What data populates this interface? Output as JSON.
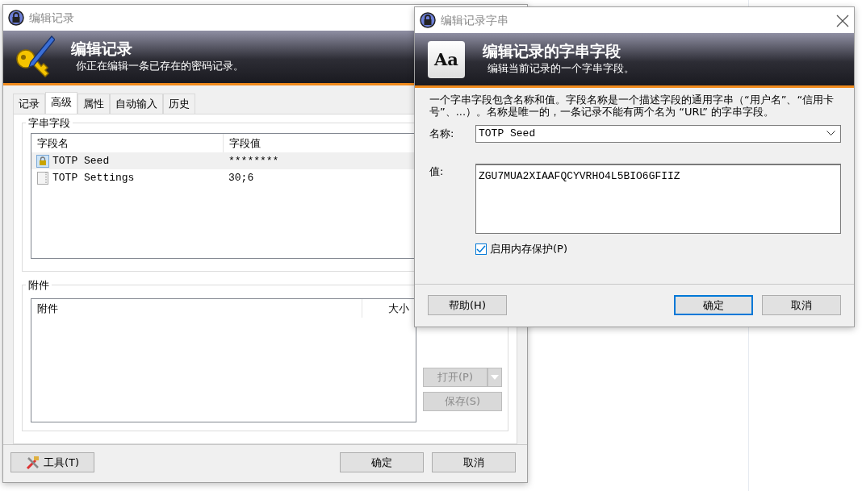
{
  "main_window": {
    "title": "编辑记录",
    "banner": {
      "title": "编辑记录",
      "subtitle": "你正在编辑一条已存在的密码记录。"
    },
    "tabs": [
      {
        "label": "记录",
        "selected": false
      },
      {
        "label": "高级",
        "selected": true
      },
      {
        "label": "属性",
        "selected": false
      },
      {
        "label": "自动输入",
        "selected": false
      },
      {
        "label": "历史",
        "selected": false
      }
    ],
    "string_fields": {
      "legend": "字串字段",
      "columns": [
        "字段名",
        "字段值"
      ],
      "rows": [
        {
          "name": "TOTP Seed",
          "value": "********",
          "protected": true,
          "selected": true
        },
        {
          "name": "TOTP Settings",
          "value": "30;6",
          "protected": false,
          "selected": false
        }
      ]
    },
    "attachments": {
      "legend": "附件",
      "columns": [
        "附件",
        "大小"
      ]
    },
    "side_buttons": [
      {
        "label": "打开(P)",
        "disabled": true,
        "kind": "split"
      },
      {
        "label": "保存(S)",
        "disabled": true,
        "kind": "plain"
      }
    ],
    "footer": {
      "tools_button": "工具(T)",
      "ok_button": "确定",
      "cancel_button": "取消"
    }
  },
  "dialog": {
    "title": "编辑记录字串",
    "banner": {
      "icon_text": "Aa",
      "title": "编辑记录的字串字段",
      "subtitle": "编辑当前记录的一个字串字段。"
    },
    "description": "一个字串字段包含名称和值。字段名称是一个描述字段的通用字串（“用户名”、“信用卡号”、...）。名称是唯一的，一条记录不能有两个名为 “URL” 的字串字段。",
    "name_label": "名称:",
    "name_value": "TOTP Seed",
    "value_label": "值:",
    "value": "ZGU7MUA2XIAAFQCYVRHO4L5BIO6GFIIZ",
    "protect": {
      "label": "启用内存保护(P)",
      "checked": true
    },
    "buttons": [
      {
        "label": "帮助(H)",
        "default": false
      },
      {
        "label": "确定",
        "default": true
      },
      {
        "label": "取消",
        "default": false
      }
    ]
  }
}
